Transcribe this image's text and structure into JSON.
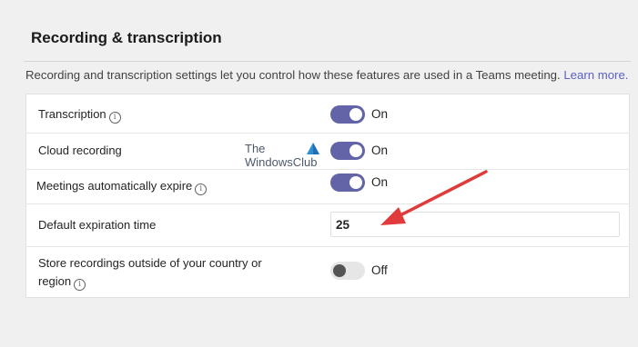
{
  "section": {
    "title": "Recording & transcription",
    "description": "Recording and transcription settings let you control how these features are used in a Teams meeting.",
    "learn_more": "Learn more."
  },
  "settings": [
    {
      "label": "Transcription",
      "has_info": true,
      "control": "toggle",
      "state": "On"
    },
    {
      "label": "Cloud recording",
      "has_info": false,
      "control": "toggle",
      "state": "On"
    },
    {
      "label": "Meetings automatically expire",
      "has_info": true,
      "control": "toggle",
      "state": "On"
    },
    {
      "label": "Default expiration time",
      "has_info": false,
      "control": "input",
      "value": "25"
    },
    {
      "label_line1": "Store recordings outside of your country or",
      "label_line2": "region",
      "has_info": true,
      "control": "toggle",
      "state": "Off"
    }
  ],
  "watermark": {
    "line1": "The",
    "line2": "WindowsClub"
  },
  "colors": {
    "toggle_on": "#6264a7",
    "accent": "#5b5fc7",
    "arrow": "#e03a3a"
  }
}
